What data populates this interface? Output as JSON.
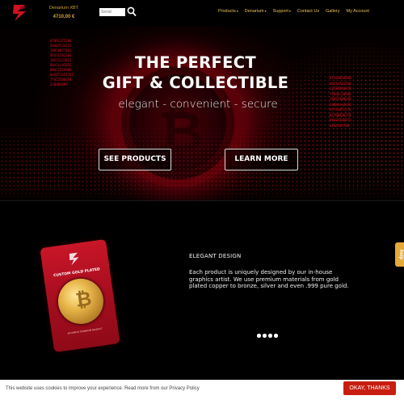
{
  "header": {
    "logo_icon": "denarium-logo-icon",
    "price_label": "Denarium XBT",
    "price_value": "4710,00 €",
    "search_placeholder": "Serial",
    "search_icon": "search-icon",
    "nav": [
      {
        "label": "Products",
        "has_dropdown": true
      },
      {
        "label": "Denarium",
        "has_dropdown": true
      },
      {
        "label": "Support",
        "has_dropdown": true
      },
      {
        "label": "Contact Us",
        "has_dropdown": false
      },
      {
        "label": "Gallery",
        "has_dropdown": false
      },
      {
        "label": "My Account",
        "has_dropdown": false
      }
    ],
    "caret": "▾"
  },
  "hero": {
    "title_line1": "THE PERFECT",
    "title_line2": "GIFT & COLLECTIBLE",
    "subtitle": "elegant - convenient - secure",
    "see_products": "SEE PRODUCTS",
    "learn_more": "LEARN MORE",
    "bitcoin_glyph": "₿",
    "code_left": [
      "87861175186",
      "56407534253",
      "18058677862",
      "844312021b6",
      "18525121823",
      "84a1cc42016",
      "88012519900",
      "8e5871151781",
      "7fd52506694",
      "2c0d84097"
    ],
    "code_right": [
      "8f2848c0400",
      "862fd7627b0",
      "c2588850175",
      "ff8a6c3d90b",
      "1465fb09e48",
      "5d0ebaa2b51",
      "8ff2e07c57b",
      "6c70843b7f8",
      "8fb2d3a6871",
      "a1bd10ff60"
    ]
  },
  "feature": {
    "card_label": "CUSTOM GOLD PLATED",
    "card_footer": "AUTHENTIC DENARIUM PRODUCT",
    "title": "ELEGANT DESIGN",
    "description": "Each product is uniquely designed by our in-house graphics artist. We use premium materials from gold plated copper to bronze, silver and even .999 pure gold.",
    "dots": 4
  },
  "help": {
    "label": "help"
  },
  "cookie": {
    "text": "This website uses cookies to improve your experience. Read more from our Privacy Policy",
    "button": "OKAY, THANKS"
  },
  "colors": {
    "accent": "#c81628",
    "gold": "#e8c15a",
    "cookie_button": "#c81e10"
  }
}
